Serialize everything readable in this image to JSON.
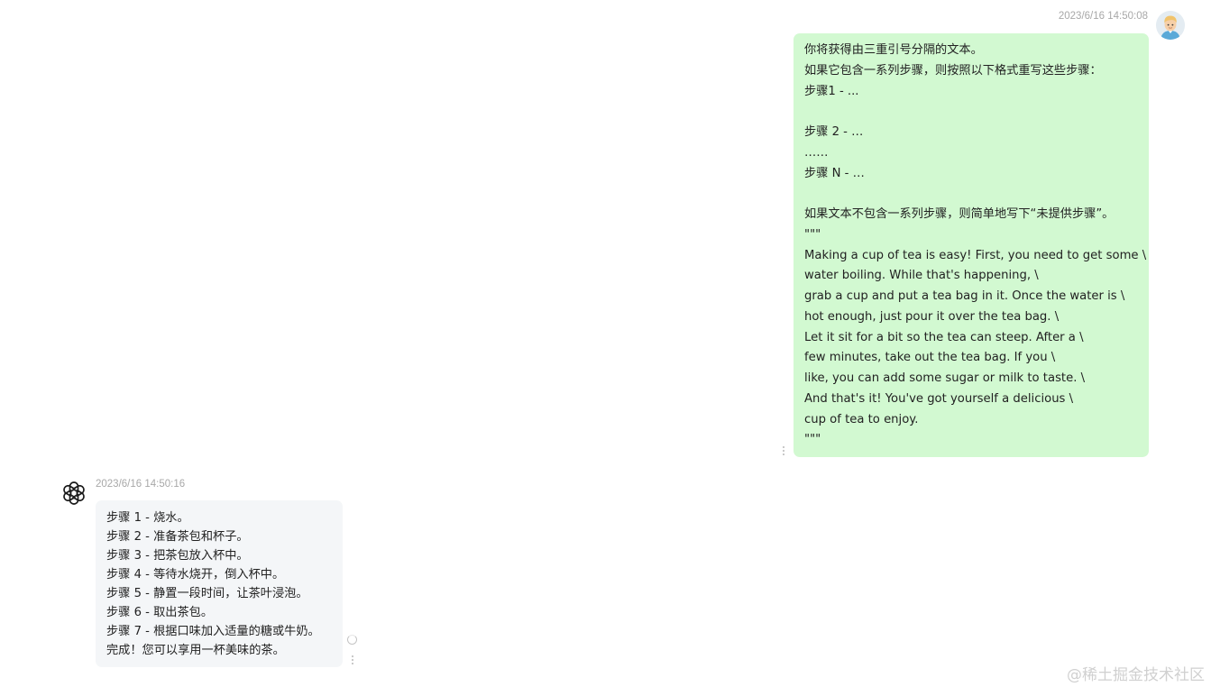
{
  "user_message": {
    "timestamp": "2023/6/16 14:50:08",
    "lines": [
      "你将获得由三重引号分隔的文本。",
      "如果它包含一系列步骤，则按照以下格式重写这些步骤：",
      "步骤1 - ...",
      "",
      "步骤 2 - …",
      "……",
      "步骤 N - …",
      "",
      "如果文本不包含一系列步骤，则简单地写下“未提供步骤”。",
      "\"\"\"",
      "Making a cup of tea is easy! First, you need to get some \\",
      "water boiling. While that's happening, \\",
      "grab a cup and put a tea bag in it. Once the water is \\",
      "hot enough, just pour it over the tea bag. \\",
      "Let it sit for a bit so the tea can steep. After a \\",
      "few minutes, take out the tea bag. If you \\",
      "like, you can add some sugar or milk to taste. \\",
      "And that's it! You've got yourself a delicious \\",
      "cup of tea to enjoy.",
      "\"\"\""
    ]
  },
  "bot_message": {
    "timestamp": "2023/6/16 14:50:16",
    "lines": [
      "步骤 1 - 烧水。",
      "步骤 2 - 准备茶包和杯子。",
      "步骤 3 - 把茶包放入杯中。",
      "步骤 4 - 等待水烧开，倒入杯中。",
      "步骤 5 - 静置一段时间，让茶叶浸泡。",
      "步骤 6 - 取出茶包。",
      "步骤 7 - 根据口味加入适量的糖或牛奶。",
      "完成！您可以享用一杯美味的茶。"
    ]
  },
  "watermark": "@稀土掘金技术社区",
  "icons": {
    "user_avatar": "user-avatar-icon",
    "bot_avatar": "openai-logo-icon",
    "more": "more-vertical-icon",
    "loading": "loading-icon"
  },
  "colors": {
    "user_bubble": "#d2f9d1",
    "bot_bubble": "#f4f6f8",
    "timestamp": "#a8a8a8"
  }
}
